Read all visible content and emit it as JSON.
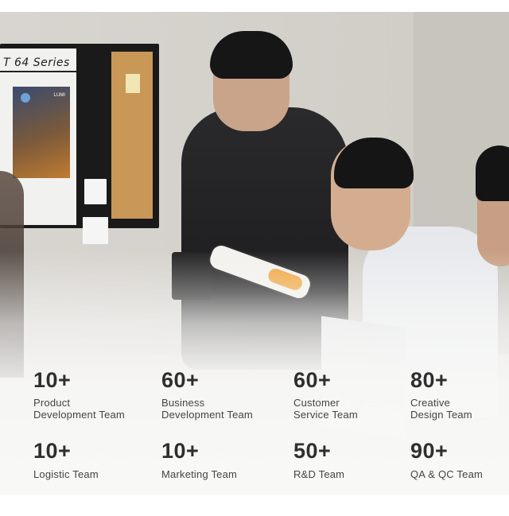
{
  "board": {
    "title": "T 64 Series",
    "poster_brand": "LUMI"
  },
  "stats": [
    {
      "value": "10+",
      "label": "Product\nDevelopment Team"
    },
    {
      "value": "60+",
      "label": "Business\nDevelopment Team"
    },
    {
      "value": "60+",
      "label": "Customer\nService Team"
    },
    {
      "value": "80+",
      "label": "Creative\nDesign Team"
    },
    {
      "value": "10+",
      "label": "Logistic Team"
    },
    {
      "value": "10+",
      "label": "Marketing Team"
    },
    {
      "value": "50+",
      "label": "R&D Team"
    },
    {
      "value": "90+",
      "label": "QA & QC Team"
    }
  ],
  "colors": {
    "text": "#2f2f2f",
    "accent_product": "#f0a640"
  }
}
